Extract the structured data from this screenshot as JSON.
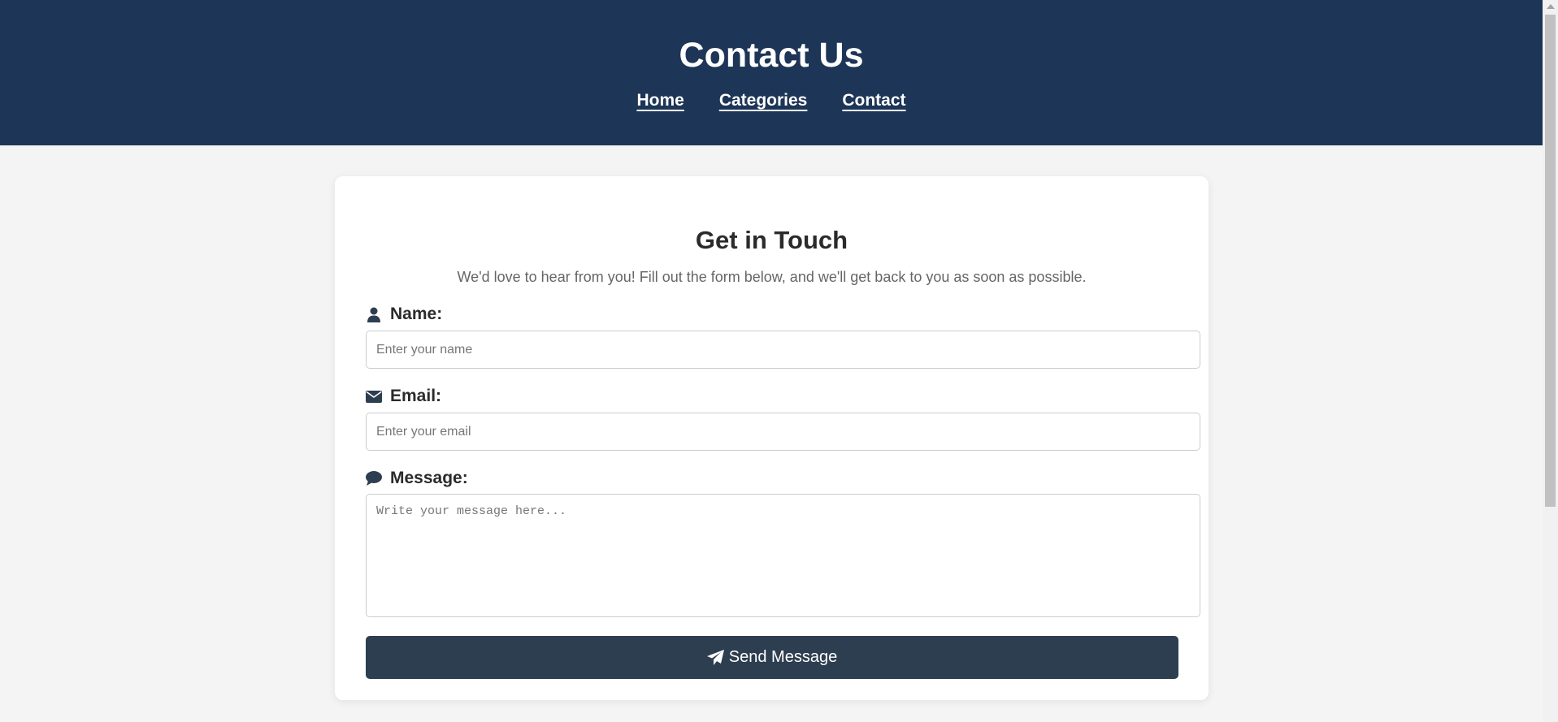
{
  "header": {
    "title": "Contact Us",
    "nav": [
      {
        "label": "Home"
      },
      {
        "label": "Categories"
      },
      {
        "label": "Contact"
      }
    ],
    "background_color": "#1d3557"
  },
  "form": {
    "heading": "Get in Touch",
    "subtitle": "We'd love to hear from you! Fill out the form below, and we'll get back to you as soon as possible.",
    "name": {
      "label": "Name:",
      "placeholder": "Enter your name",
      "icon": "user-icon"
    },
    "email": {
      "label": "Email:",
      "placeholder": "Enter your email",
      "icon": "envelope-icon"
    },
    "message": {
      "label": "Message:",
      "placeholder": "Write your message here...",
      "icon": "comment-icon"
    },
    "submit": {
      "label": "Send Message",
      "icon": "paper-plane-icon"
    },
    "button_color": "#2d3e50"
  }
}
